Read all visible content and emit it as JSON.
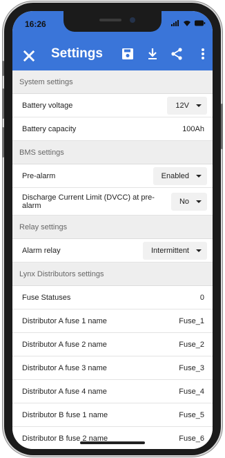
{
  "status": {
    "time": "16:26"
  },
  "appbar": {
    "title": "Settings"
  },
  "sections": {
    "system": {
      "title": "System settings",
      "battery_voltage": {
        "label": "Battery voltage",
        "value": "12V"
      },
      "battery_capacity": {
        "label": "Battery capacity",
        "value": "100Ah"
      }
    },
    "bms": {
      "title": "BMS settings",
      "pre_alarm": {
        "label": "Pre-alarm",
        "value": "Enabled"
      },
      "dvcc": {
        "label": "Discharge Current Limit (DVCC) at pre-alarm",
        "value": "No"
      }
    },
    "relay": {
      "title": "Relay settings",
      "alarm_relay": {
        "label": "Alarm relay",
        "value": "Intermittent"
      }
    },
    "lynx": {
      "title": "Lynx Distributors settings",
      "rows": [
        {
          "label": "Fuse Statuses",
          "value": "0"
        },
        {
          "label": "Distributor A fuse 1 name",
          "value": "Fuse_1"
        },
        {
          "label": "Distributor A fuse 2 name",
          "value": "Fuse_2"
        },
        {
          "label": "Distributor A fuse 3 name",
          "value": "Fuse_3"
        },
        {
          "label": "Distributor A fuse 4 name",
          "value": "Fuse_4"
        },
        {
          "label": "Distributor B fuse 1 name",
          "value": "Fuse_5"
        },
        {
          "label": "Distributor B fuse 2 name",
          "value": "Fuse_6"
        }
      ]
    }
  },
  "icons": {
    "close": "close-icon",
    "save": "save-icon",
    "download": "download-icon",
    "share": "share-icon",
    "more": "more-vert-icon"
  },
  "colors": {
    "appbar": "#3a75d9",
    "section_bg": "#eeeeee",
    "select_bg": "#f1f1f1"
  }
}
